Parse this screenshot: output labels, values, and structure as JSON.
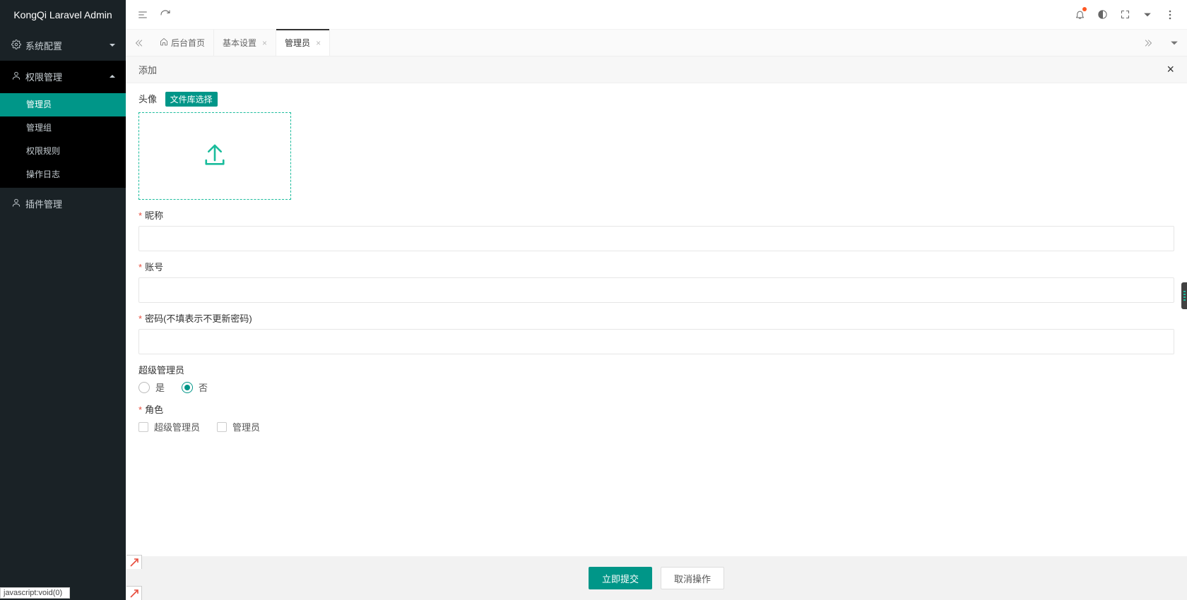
{
  "brand": "KongQi Laravel Admin",
  "sidebar": {
    "system_label": "系统配置",
    "perm_label": "权限管理",
    "plugin_label": "插件管理",
    "perm_items": [
      {
        "label": "管理员"
      },
      {
        "label": "管理组"
      },
      {
        "label": "权限规则"
      },
      {
        "label": "操作日志"
      }
    ]
  },
  "tabs": {
    "home": "后台首页",
    "items": [
      {
        "label": "基本设置",
        "active": false
      },
      {
        "label": "管理员",
        "active": true
      }
    ]
  },
  "subhead": {
    "title": "添加"
  },
  "form": {
    "avatar_label": "头像",
    "file_select_label": "文件库选择",
    "nickname_label": "昵称",
    "account_label": "账号",
    "password_label": "密码(不填表示不更新密码)",
    "super_label": "超级管理员",
    "radio_yes": "是",
    "radio_no": "否",
    "role_label": "角色",
    "role_options": [
      {
        "label": "超级管理员"
      },
      {
        "label": "管理员"
      }
    ]
  },
  "footer": {
    "submit": "立即提交",
    "cancel": "取消操作"
  },
  "status_text": "javascript:void(0)"
}
